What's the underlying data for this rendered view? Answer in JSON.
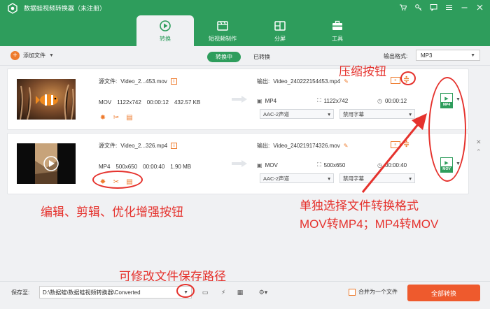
{
  "window": {
    "title": "数据蛙视频转换器（未注册）",
    "buttons": [
      "cart-icon",
      "key-icon",
      "feedback-icon",
      "menu-icon",
      "minimize-icon",
      "close-icon"
    ]
  },
  "tabs": [
    {
      "label": "转换",
      "icon": "convert-icon",
      "active": true
    },
    {
      "label": "短视频制作",
      "icon": "video-edit-icon",
      "active": false
    },
    {
      "label": "分屏",
      "icon": "split-screen-icon",
      "active": false
    },
    {
      "label": "工具",
      "icon": "toolbox-icon",
      "active": false
    }
  ],
  "toolbar": {
    "add_file": "添加文件",
    "converting": "转换中",
    "converted": "已转换",
    "output_format_label": "输出格式:",
    "output_format_value": "MP3"
  },
  "files": [
    {
      "source_label": "源文件:",
      "source_name": "Video_2...453.mov",
      "format": "MOV",
      "resolution": "1122x742",
      "duration": "00:00:12",
      "size": "432.57 KB",
      "output_label": "输出:",
      "output_name": "Video_240222154453.mp4",
      "out_format": "MP4",
      "out_resolution": "1122x742",
      "out_duration": "00:00:12",
      "audio": "AAC-2声道",
      "subtitle": "禁用字幕",
      "format_badge": "MP4"
    },
    {
      "source_label": "源文件:",
      "source_name": "Video_2...326.mp4",
      "format": "MP4",
      "resolution": "500x650",
      "duration": "00:00:40",
      "size": "1.90 MB",
      "output_label": "输出:",
      "output_name": "Video_240219174326.mov",
      "out_format": "MOV",
      "out_resolution": "500x650",
      "out_duration": "00:00:40",
      "audio": "AAC-2声道",
      "subtitle": "禁用字幕",
      "format_badge": "MOV"
    }
  ],
  "annotations": {
    "compress": "压缩按钮",
    "edit_buttons": "编辑、剪辑、优化增强按钮",
    "format_line1": "单独选择文件转换格式",
    "format_line2": "MOV转MP4；MP4转MOV",
    "save_path": "可修改文件保存路径"
  },
  "bottom": {
    "save_to": "保存至:",
    "path": "D:\\数据蛙\\数据蛙视频转换器\\Converted",
    "merge": "合并为一个文件",
    "convert_all": "全部转换"
  },
  "colors": {
    "brand_green": "#2e9d5c",
    "accent_orange": "#ee7b2d",
    "annotation_red": "#e5322d"
  }
}
